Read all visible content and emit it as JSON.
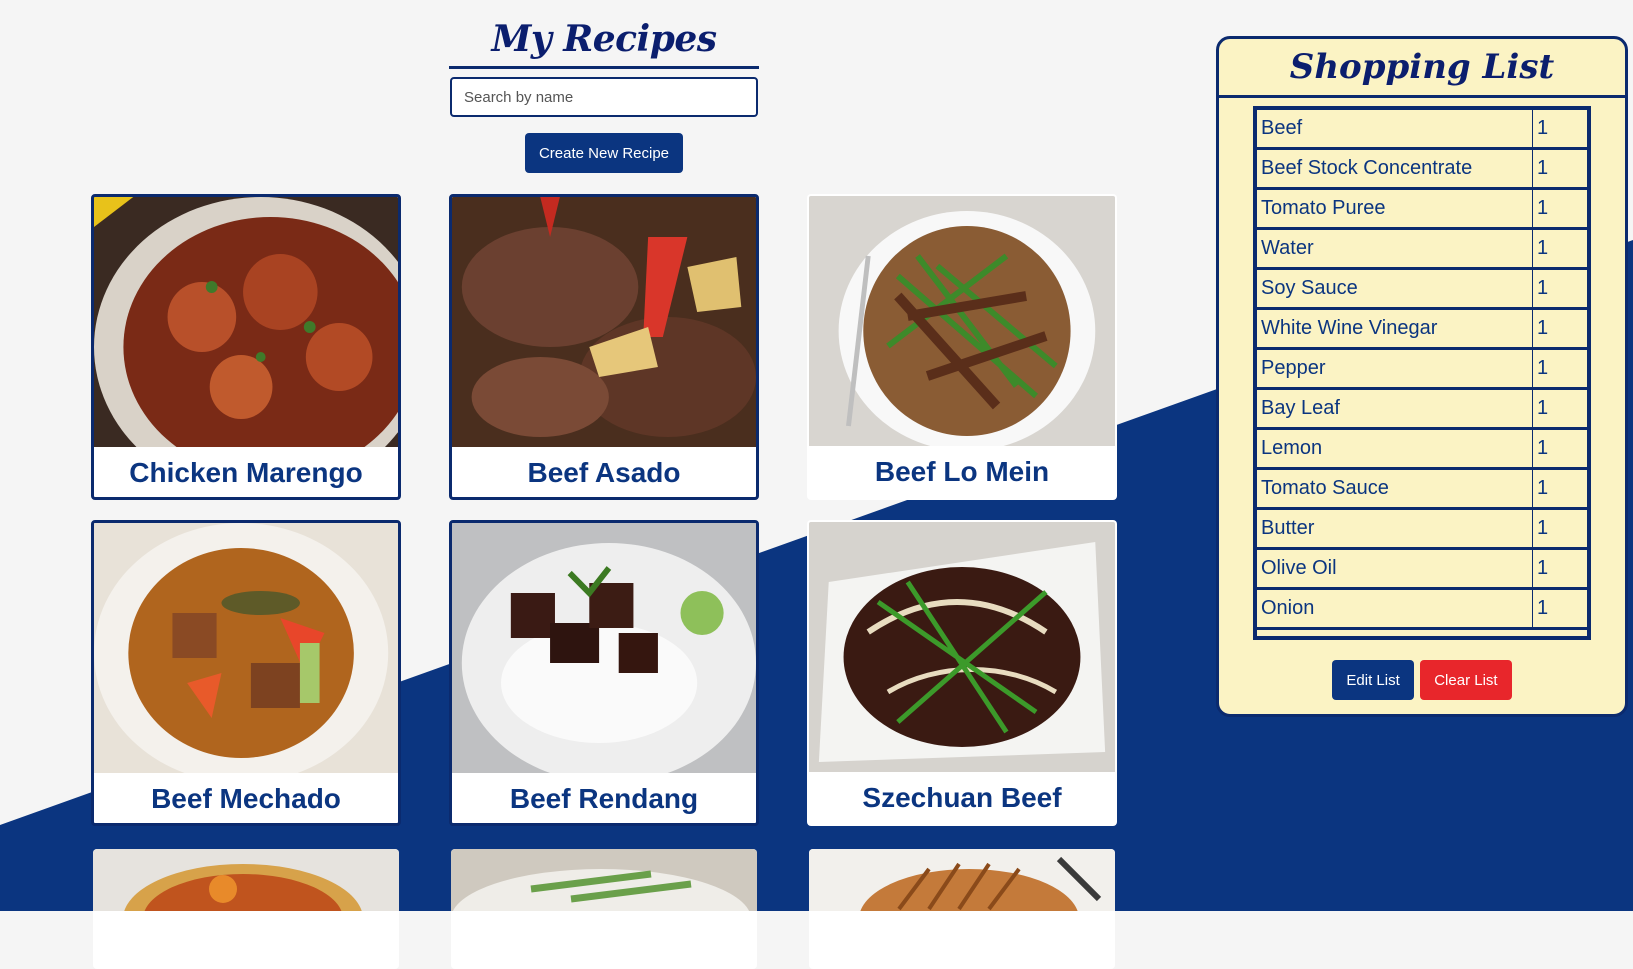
{
  "header": {
    "title": "My Recipes",
    "search_placeholder": "Search by name",
    "create_label": "Create New Recipe"
  },
  "recipes": [
    {
      "name": "Chicken Marengo",
      "image": "chicken-marengo-photo"
    },
    {
      "name": "Beef Asado",
      "image": "beef-asado-photo"
    },
    {
      "name": "Beef Lo Mein",
      "image": "beef-lo-mein-photo"
    },
    {
      "name": "Beef Mechado",
      "image": "beef-mechado-photo"
    },
    {
      "name": "Beef Rendang",
      "image": "beef-rendang-photo"
    },
    {
      "name": "Szechuan Beef",
      "image": "szechuan-beef-photo"
    }
  ],
  "shopping_list": {
    "title": "Shopping List",
    "items": [
      {
        "name": "Beef",
        "qty": "1"
      },
      {
        "name": "Beef Stock Concentrate",
        "qty": "1"
      },
      {
        "name": "Tomato Puree",
        "qty": "1"
      },
      {
        "name": "Water",
        "qty": "1"
      },
      {
        "name": "Soy Sauce",
        "qty": "1"
      },
      {
        "name": "White Wine Vinegar",
        "qty": "1"
      },
      {
        "name": "Pepper",
        "qty": "1"
      },
      {
        "name": "Bay Leaf",
        "qty": "1"
      },
      {
        "name": "Lemon",
        "qty": "1"
      },
      {
        "name": "Tomato Sauce",
        "qty": "1"
      },
      {
        "name": "Butter",
        "qty": "1"
      },
      {
        "name": "Olive Oil",
        "qty": "1"
      },
      {
        "name": "Onion",
        "qty": "1"
      }
    ],
    "edit_label": "Edit List",
    "clear_label": "Clear List"
  },
  "colors": {
    "primary": "#0b3580",
    "danger": "#e8262b",
    "panel": "#fbf3c4",
    "background": "#f5f5f5"
  }
}
